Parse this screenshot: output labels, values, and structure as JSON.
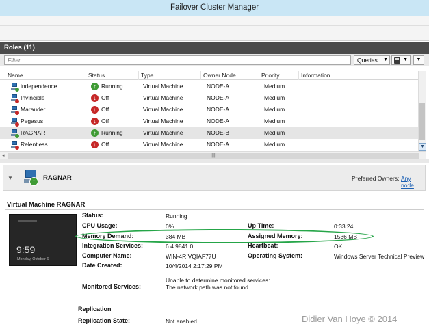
{
  "window": {
    "title": "Failover Cluster Manager"
  },
  "roles_pane": {
    "title": "Roles (11)",
    "filter_placeholder": "Filter",
    "queries_label": "Queries",
    "columns": [
      "Name",
      "Status",
      "Type",
      "Owner Node",
      "Priority",
      "Information"
    ],
    "rows": [
      {
        "name": "independence",
        "status": "Running",
        "type": "Virtual Machine",
        "owner": "NODE-A",
        "priority": "Medium",
        "information": ""
      },
      {
        "name": "Invincible",
        "status": "Off",
        "type": "Virtual Machine",
        "owner": "NODE-A",
        "priority": "Medium",
        "information": ""
      },
      {
        "name": "Marauder",
        "status": "Off",
        "type": "Virtual Machine",
        "owner": "NODE-A",
        "priority": "Medium",
        "information": ""
      },
      {
        "name": "Pegasus",
        "status": "Off",
        "type": "Virtual Machine",
        "owner": "NODE-A",
        "priority": "Medium",
        "information": ""
      },
      {
        "name": "RAGNAR",
        "status": "Running",
        "type": "Virtual Machine",
        "owner": "NODE-B",
        "priority": "Medium",
        "information": ""
      },
      {
        "name": "Relentless",
        "status": "Off",
        "type": "Virtual Machine",
        "owner": "NODE-A",
        "priority": "Medium",
        "information": ""
      }
    ]
  },
  "detail": {
    "role_name": "RAGNAR",
    "preferred_owners_label": "Preferred Owners:",
    "any_node_link": "Any node",
    "section_title": "Virtual Machine RAGNAR",
    "thumbnail": {
      "time": "9:59",
      "date": "Monday, October 6"
    },
    "fields": {
      "status_label": "Status:",
      "status_value": "Running",
      "cpu_label": "CPU Usage:",
      "cpu_value": "0%",
      "uptime_label": "Up Time:",
      "uptime_value": "0:33:24",
      "memdemand_label": "Memory Demand:",
      "memdemand_value": "384 MB",
      "assigned_label": "Assigned Memory:",
      "assigned_value": "1536 MB",
      "integration_label": "Integration Services:",
      "integration_value": "6.4.9841.0",
      "heartbeat_label": "Heartbeat:",
      "heartbeat_value": "OK",
      "computer_label": "Computer Name:",
      "computer_value": "WIN-4RIVQIAF77U",
      "os_label": "Operating System:",
      "os_value": "Windows Server Technical Preview",
      "created_label": "Date Created:",
      "created_value": "10/4/2014 2:17:29 PM",
      "monitored_label": "Monitored Services:",
      "monitored_line1": "Unable to determine monitored services:",
      "monitored_line2": "The network path was not found."
    },
    "replication": {
      "title": "Replication",
      "state_label": "Replication State:",
      "state_value": "Not enabled"
    }
  },
  "watermark": "Didier Van Hoye © 2014",
  "colors": {
    "highlight_oval": "#25a548",
    "title_bar": "#c9e6f5",
    "pane_header": "#4b4b4b"
  }
}
